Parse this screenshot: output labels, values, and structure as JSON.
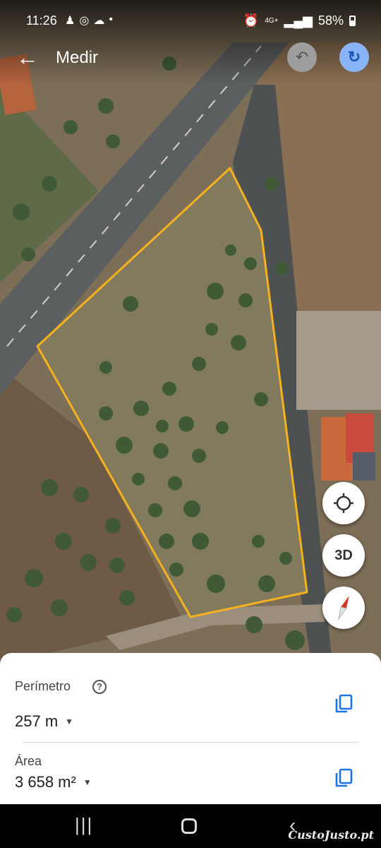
{
  "status_bar": {
    "time": "11:26",
    "notification_icons": [
      "person-icon",
      "chrome-icon",
      "cloud-icon",
      "dot-icon"
    ],
    "right_icons": [
      "alarm-icon",
      "network-4g-icon",
      "signal-icon"
    ],
    "network": "4G+",
    "battery": "58%"
  },
  "toolbar": {
    "title": "Medir",
    "back_icon": "arrow-left-icon",
    "undo_icon": "undo-icon",
    "redo_icon": "redo-icon"
  },
  "map": {
    "threed_label": "3D",
    "measured_shape_color": "#f5b21e"
  },
  "measurements": {
    "perimeter_label": "Perímetro",
    "perimeter_value": "257 m",
    "area_label": "Área",
    "area_value": "3 658 m²"
  },
  "nav_bar": {
    "recents_glyph": "|||",
    "back_glyph": "‹"
  },
  "watermark": "CustoJusto.pt",
  "colors": {
    "accent_blue": "#1a73e8",
    "redo_bg": "#8ab4f8",
    "undo_bg": "#9e9e9e"
  }
}
